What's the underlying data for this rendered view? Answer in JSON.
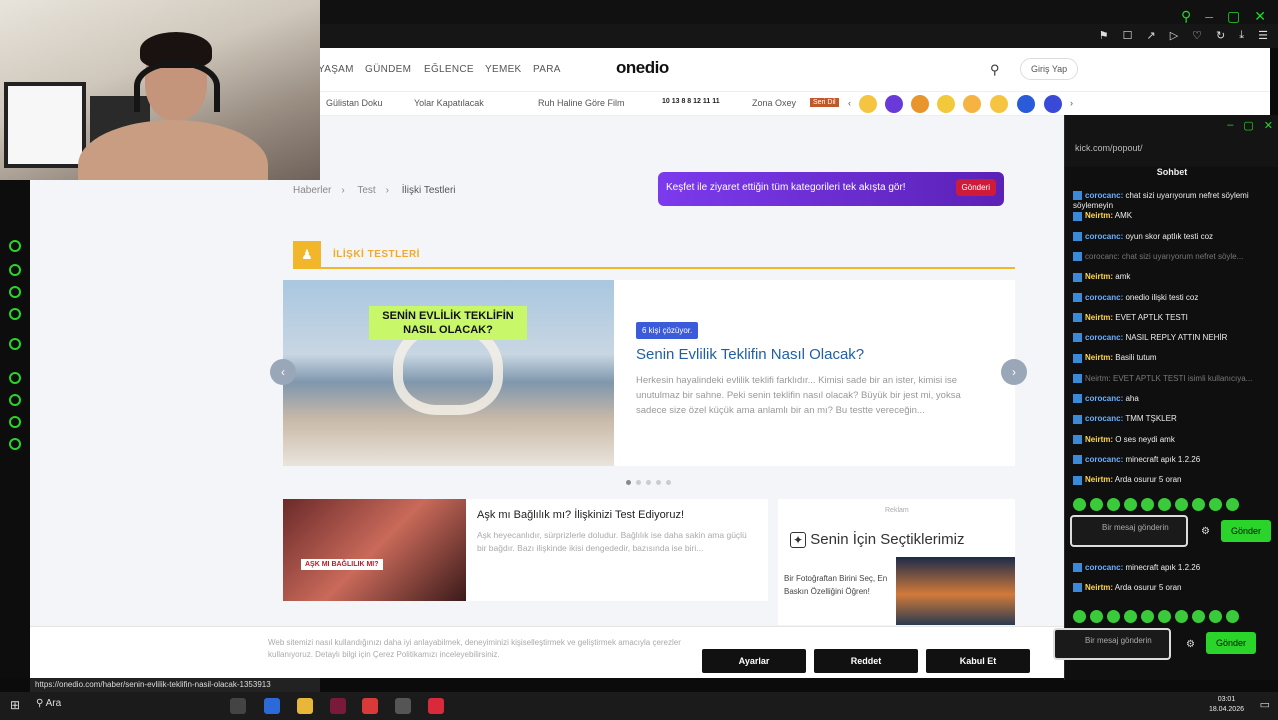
{
  "nav": {
    "items": [
      "YAŞAM",
      "GÜNDEM",
      "EĞLENCE",
      "YEMEK",
      "PARA"
    ],
    "logo": "onedio",
    "login": "Giriş Yap"
  },
  "subnav": {
    "items": [
      "Gülistan Doku",
      "Yolar Kapatılacak",
      "Ruh Haline Göre Film",
      "10 13 8 8 12 11 11",
      "Zona Oxey",
      "Seri Dil"
    ]
  },
  "breadcrumb": [
    "Haberler",
    "Test",
    "İlişki Testleri"
  ],
  "banner": {
    "text": "Keşfet ile ziyaret ettiğin tüm kategorileri tek akışta gör!",
    "button": "Gönderi"
  },
  "section": {
    "title": "İLİŞKİ TESTLERİ"
  },
  "slide": {
    "image_label": "SENİN EVLİLİK TEKLİFİN NASIL OLACAK?",
    "badge": "6 kişi çözüyor.",
    "title": "Senin Evlilik Teklifin Nasıl Olacak?",
    "desc": "Herkesin hayalindeki evlilik teklifi farklıdır... Kimisi sade bir an ister, kimisi ise unutulmaz bir sahne. Peki senin teklifin nasıl olacak? Büyük bir jest mi, yoksa sadece size özel küçük ama anlamlı bir an mı? Bu testte vereceğin..."
  },
  "card1": {
    "image_label": "AŞK MI BAĞLILIK MI?",
    "title": "Aşk mı Bağlılık mı? İlişkinizi Test Ediyoruz!",
    "desc": "Aşk heyecanlıdır, sürprizlerle doludur. Bağlılık ise daha sakin ama güçlü bir bağdır. Bazı ilişkinde ikisi dengededir, bazısında ise biri..."
  },
  "sidebar": {
    "top": "Reklam",
    "heading": "Senin İçin Seçtiklerimiz",
    "item": "Bir Fotoğraftan Birini Seç, En Baskın Özelliğini Öğren!"
  },
  "cookie": {
    "text": "Web sitemizi nasıl kullandığınızı daha iyi anlayabilmek, deneyiminizi kişiselleştirmek ve geliştirmek amacıyla çerezler kullanıyoruz. Detaylı bilgi için Çerez Politikamızı inceleyebilirsiniz.",
    "buttons": [
      "Ayarlar",
      "Reddet",
      "Kabul Et"
    ]
  },
  "chat": {
    "url": "kick.com/popout/",
    "header": "Sohbet",
    "messages": [
      {
        "user": "corocanc:",
        "text": " chat sizi uyarıyorum nefret söylemi söylemeyin"
      },
      {
        "user": "Neirtm:",
        "text": " AMK"
      },
      {
        "user": "corocanc:",
        "text": " oyun skor aptlık testi coz"
      },
      {
        "user": "",
        "text": "corocanc: chat sizi uyarıyorum nefret söyle..."
      },
      {
        "user": "Neirtm:",
        "text": " amk"
      },
      {
        "user": "corocanc:",
        "text": " onedio ilişki testi coz"
      },
      {
        "user": "Neirtm:",
        "text": " EVET APTLK TESTI"
      },
      {
        "user": "corocanc:",
        "text": " NASIL REPLY ATTIN NEHİR"
      },
      {
        "user": "Neirtm:",
        "text": " Basili tutum"
      },
      {
        "user": "",
        "text": "Neirtm: EVET APTLK TESTI isimli kullanıcıya..."
      },
      {
        "user": "corocanc:",
        "text": " aha"
      },
      {
        "user": "corocanc:",
        "text": " TMM TŞKLER"
      },
      {
        "user": "Neirtm:",
        "text": " O ses neydi amk"
      },
      {
        "user": "corocanc:",
        "text": " minecraft apık 1.2.26"
      },
      {
        "user": "Neirtm:",
        "text": " Arda osurur 5 oran"
      }
    ],
    "messages2": [
      {
        "user": "corocanc:",
        "text": " minecraft apık 1.2.26"
      },
      {
        "user": "Neirtm:",
        "text": " Arda osurur 5 oran"
      }
    ],
    "placeholder": "Bir mesaj gönderin",
    "send": "Gönder"
  },
  "status_url": "https://onedio.com/haber/senin-evlilik-teklifin-nasil-olacak-1353913",
  "taskbar": {
    "search": "Ara",
    "time": "03:01",
    "date": "18.04.2026"
  }
}
